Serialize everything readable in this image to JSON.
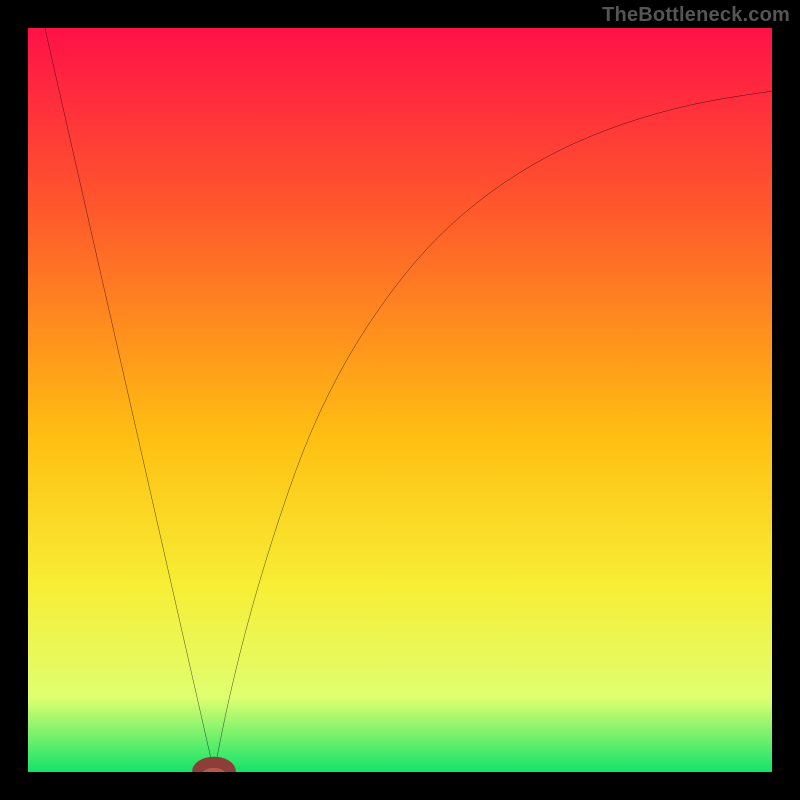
{
  "watermark": "TheBottleneck.com",
  "chart_data": {
    "type": "line",
    "title": "",
    "xlabel": "",
    "ylabel": "",
    "xlim": [
      0,
      100
    ],
    "ylim": [
      0,
      100
    ],
    "gradient_stops": [
      {
        "offset": 0,
        "color": "#ff1148"
      },
      {
        "offset": 25,
        "color": "#ff5a2b"
      },
      {
        "offset": 55,
        "color": "#ffbf12"
      },
      {
        "offset": 75,
        "color": "#f7ee35"
      },
      {
        "offset": 90,
        "color": "#dfff70"
      },
      {
        "offset": 100,
        "color": "#12e36a"
      }
    ],
    "series": [
      {
        "name": "left-branch",
        "x": [
          0,
          25
        ],
        "y": [
          110,
          0
        ]
      },
      {
        "name": "right-branch",
        "x": [
          25,
          27,
          30,
          34,
          38,
          43,
          49,
          55,
          62,
          70,
          78,
          86,
          93,
          100
        ],
        "y": [
          0,
          10,
          22,
          35,
          46,
          56,
          65,
          72,
          78,
          83,
          86.5,
          89,
          90.5,
          91.5
        ]
      }
    ],
    "marker": {
      "x": 25,
      "y": 0,
      "rx": 2.2,
      "ry": 1.3
    }
  }
}
